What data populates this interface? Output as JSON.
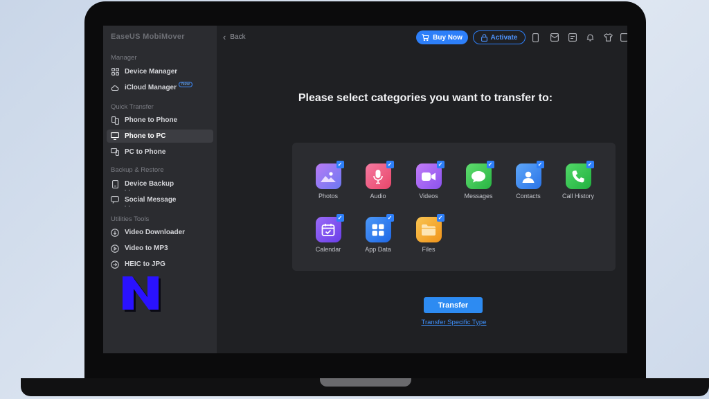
{
  "app": {
    "title": "EaseUS MobiMover"
  },
  "sidebar": {
    "sections": [
      {
        "label": "Manager"
      },
      {
        "label": "Quick Transfer"
      },
      {
        "label": "Backup & Restore"
      },
      {
        "label": "Utilities Tools"
      }
    ],
    "items": [
      {
        "label": "Device Manager",
        "icon": "grid-icon"
      },
      {
        "label": "iCloud Manager",
        "icon": "cloud-icon",
        "badge": "New"
      },
      {
        "label": "Phone to Phone",
        "icon": "phone-to-phone-icon"
      },
      {
        "label": "Phone to PC",
        "icon": "phone-to-pc-icon",
        "active": true
      },
      {
        "label": "PC to Phone",
        "icon": "pc-to-phone-icon"
      },
      {
        "label": "Device Backup",
        "icon": "device-backup-icon",
        "sub": "• •"
      },
      {
        "label": "Social Message",
        "icon": "social-message-icon",
        "sub": "• •"
      },
      {
        "label": "Video Downloader",
        "icon": "video-download-icon"
      },
      {
        "label": "Video to MP3",
        "icon": "video-mp3-icon"
      },
      {
        "label": "HEIC to JPG",
        "icon": "heic-jpg-icon"
      }
    ]
  },
  "header": {
    "back_label": "Back",
    "buy_label": "Buy Now",
    "activate_label": "Activate",
    "icons": [
      "device-icon",
      "mail-icon",
      "feedback-icon",
      "bell-icon",
      "shirt-icon",
      "menu-icon"
    ]
  },
  "main": {
    "heading": "Please select categories you want to transfer to:",
    "categories": [
      {
        "label": "Photos",
        "icon": "photos-icon",
        "color": "#8a6cf0",
        "checked": true
      },
      {
        "label": "Audio",
        "icon": "audio-icon",
        "color": "#f0567a",
        "checked": true
      },
      {
        "label": "Videos",
        "icon": "videos-icon",
        "color": "#a45cf0",
        "checked": true
      },
      {
        "label": "Messages",
        "icon": "messages-icon",
        "color": "#35c353",
        "checked": true
      },
      {
        "label": "Contacts",
        "icon": "contacts-icon",
        "color": "#3a8ff5",
        "checked": true
      },
      {
        "label": "Call History",
        "icon": "call-history-icon",
        "color": "#2fc14e",
        "checked": true
      },
      {
        "label": "Calendar",
        "icon": "calendar-icon",
        "color": "#7f52f2",
        "checked": true
      },
      {
        "label": "App Data",
        "icon": "app-data-icon",
        "color": "#2f7ff3",
        "checked": true
      },
      {
        "label": "Files",
        "icon": "files-icon",
        "color": "#f5a11c",
        "checked": true
      }
    ],
    "transfer_label": "Transfer",
    "specific_link": "Transfer Specific Type"
  },
  "colors": {
    "accent": "#2d7ff9",
    "panel": "#2b2c30",
    "sidebar": "#2b2c30",
    "background": "#1f2023"
  }
}
